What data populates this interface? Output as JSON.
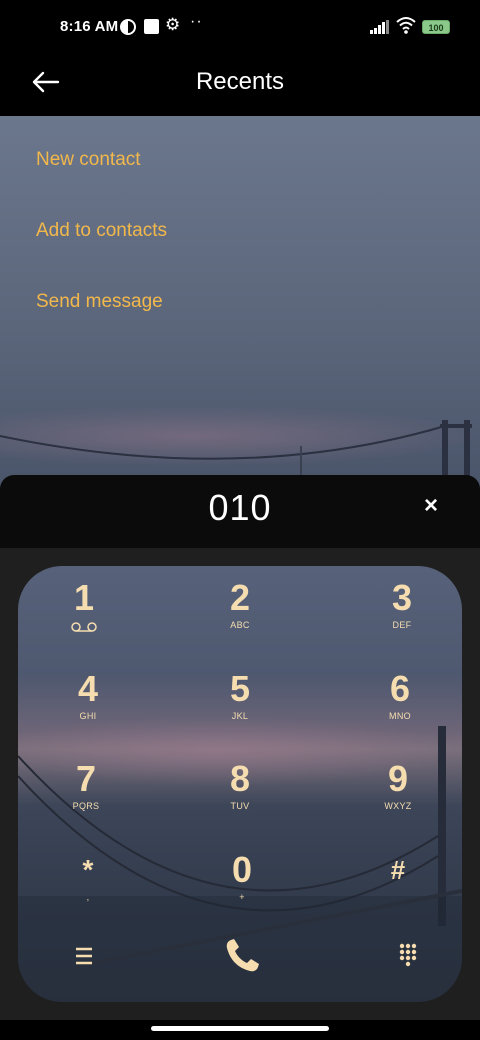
{
  "status": {
    "time": "8:16 AM",
    "battery": "100",
    "icons": [
      "moon-icon",
      "square-icon",
      "gear-icon",
      "more-dots-icon",
      "signal-icon",
      "wifi-icon",
      "battery-icon"
    ]
  },
  "header": {
    "title": "Recents",
    "back_icon": "back-arrow-icon"
  },
  "menu": {
    "items": [
      {
        "label": "New contact"
      },
      {
        "label": "Add to contacts"
      },
      {
        "label": "Send message"
      }
    ]
  },
  "dialer": {
    "number": "010",
    "clear_label": "×",
    "keys": [
      {
        "digit": "1",
        "letters": ""
      },
      {
        "digit": "2",
        "letters": "ABC"
      },
      {
        "digit": "3",
        "letters": "DEF"
      },
      {
        "digit": "4",
        "letters": "GHI"
      },
      {
        "digit": "5",
        "letters": "JKL"
      },
      {
        "digit": "6",
        "letters": "MNO"
      },
      {
        "digit": "7",
        "letters": "PQRS"
      },
      {
        "digit": "8",
        "letters": "TUV"
      },
      {
        "digit": "9",
        "letters": "WXYZ"
      },
      {
        "digit": "*",
        "letters": ","
      },
      {
        "digit": "0",
        "letters": "+"
      },
      {
        "digit": "#",
        "letters": ""
      }
    ],
    "bottom_icons": [
      "menu-icon",
      "call-icon",
      "dialpad-icon"
    ]
  },
  "colors": {
    "accent": "#f2b84b",
    "key_text": "#f6ddb0",
    "background": "#000000"
  }
}
